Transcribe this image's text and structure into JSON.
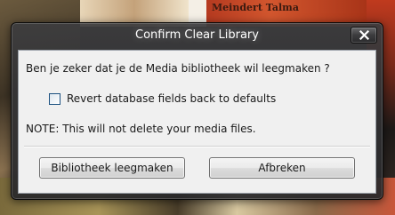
{
  "background": {
    "album_caption": "Meindert Talma"
  },
  "dialog": {
    "title": "Confirm Clear Library",
    "question": "Ben je zeker dat je de Media bibliotheek wil leegmaken ?",
    "checkbox": {
      "label": "Revert database fields back to defaults",
      "checked": false
    },
    "note": "NOTE: This will not delete your media files.",
    "buttons": {
      "confirm_label": "Bibliotheek leegmaken",
      "cancel_label": "Afbreken"
    }
  },
  "colors": {
    "frame": "#3c3c3e",
    "client_background": "#f0f0f0",
    "title_text": "#ffffff",
    "checkbox_border": "#1c5180"
  },
  "icons": {
    "close": "close-icon"
  }
}
